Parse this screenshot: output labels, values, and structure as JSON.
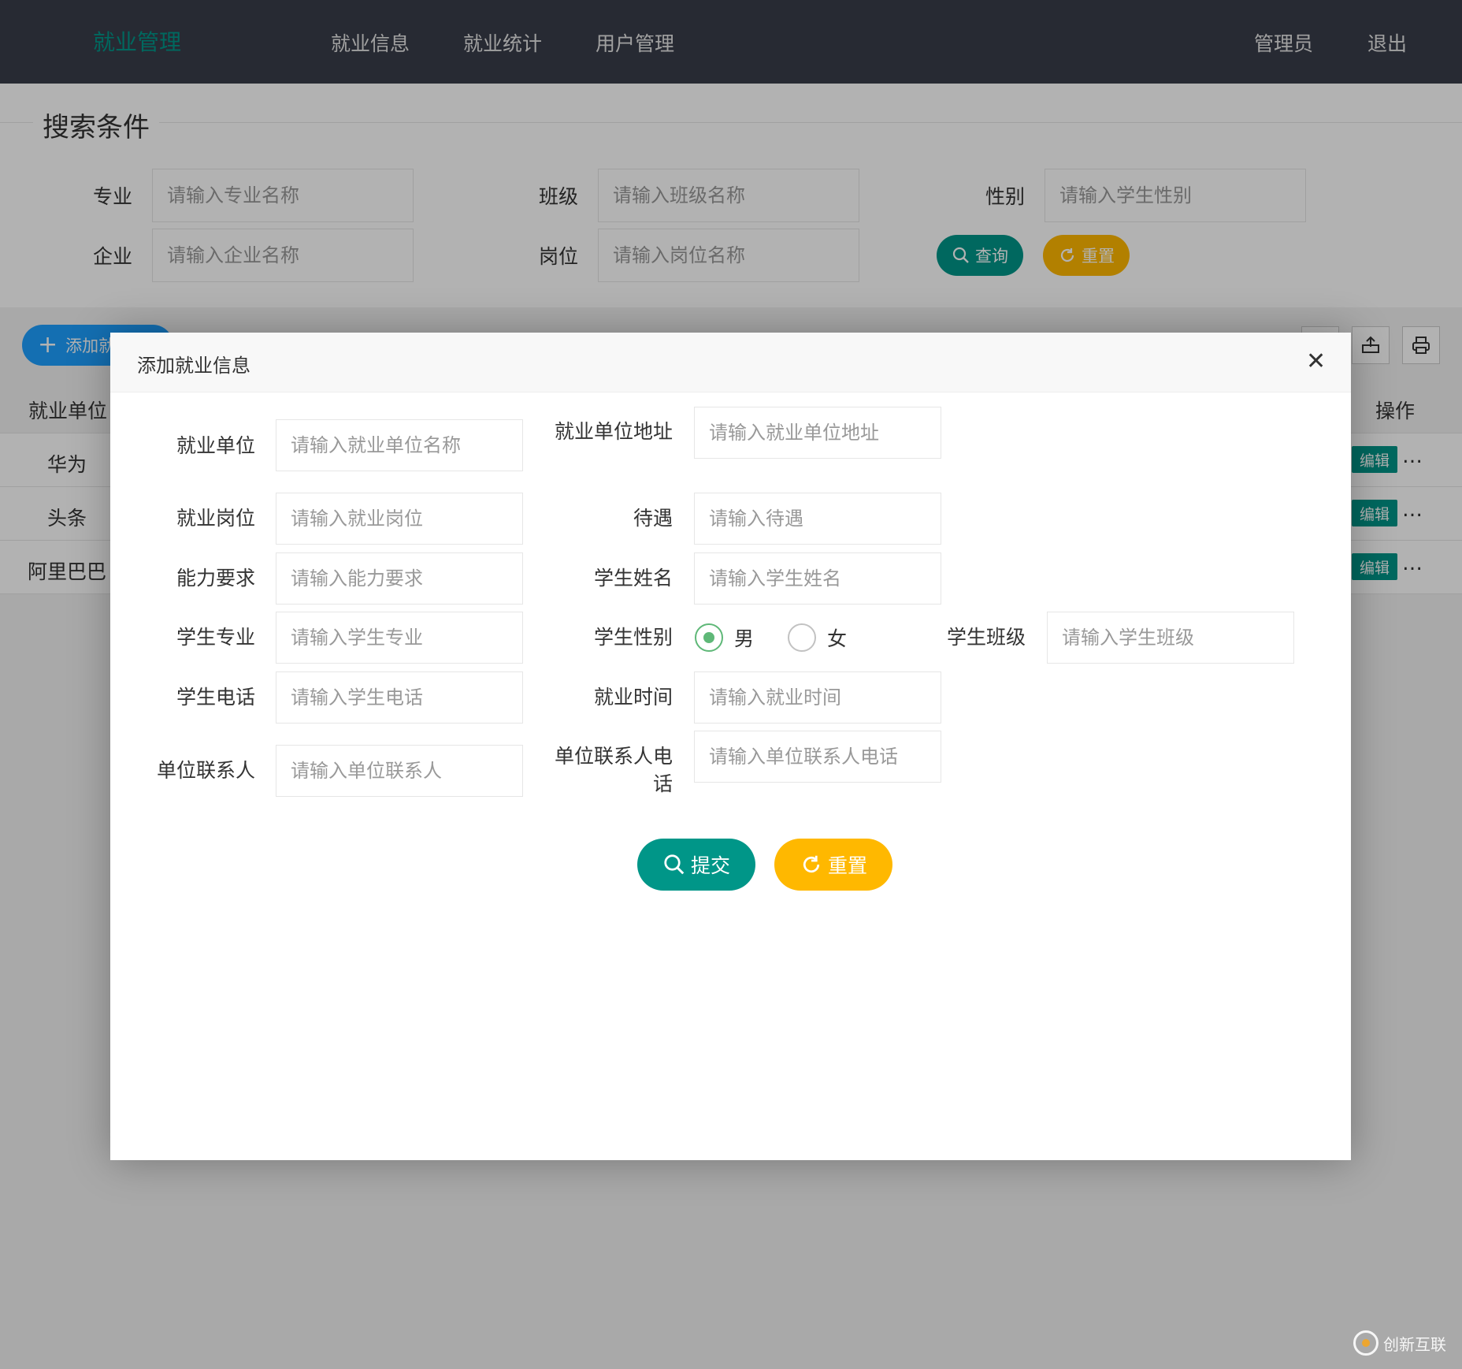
{
  "header": {
    "logo": "就业管理",
    "nav": [
      "就业信息",
      "就业统计",
      "用户管理"
    ],
    "admin": "管理员",
    "logout": "退出"
  },
  "search": {
    "legend": "搜索条件",
    "major_label": "专业",
    "major_placeholder": "请输入专业名称",
    "class_label": "班级",
    "class_placeholder": "请输入班级名称",
    "gender_label": "性别",
    "gender_placeholder": "请输入学生性别",
    "company_label": "企业",
    "company_placeholder": "请输入企业名称",
    "position_label": "岗位",
    "position_placeholder": "请输入岗位名称",
    "query_label": "查询",
    "reset_label": "重置"
  },
  "toolbar": {
    "add_label": "添加就"
  },
  "table": {
    "headers": {
      "unit": "就业单位",
      "op": "操作"
    },
    "rows": [
      {
        "unit": "华为"
      },
      {
        "unit": "头条"
      },
      {
        "unit": "阿里巴巴"
      }
    ],
    "edit_label": "编辑",
    "more_label": "…"
  },
  "modal": {
    "title": "添加就业信息",
    "close": "✕",
    "fields": {
      "unit": {
        "label": "就业单位",
        "placeholder": "请输入就业单位名称"
      },
      "address": {
        "label": "就业单位地址",
        "placeholder": "请输入就业单位地址"
      },
      "post": {
        "label": "就业岗位",
        "placeholder": "请输入就业岗位"
      },
      "salary": {
        "label": "待遇",
        "placeholder": "请输入待遇"
      },
      "ability": {
        "label": "能力要求",
        "placeholder": "请输入能力要求"
      },
      "name": {
        "label": "学生姓名",
        "placeholder": "请输入学生姓名"
      },
      "major": {
        "label": "学生专业",
        "placeholder": "请输入学生专业"
      },
      "gender": {
        "label": "学生性别",
        "options": [
          "男",
          "女"
        ],
        "selected": "男"
      },
      "class": {
        "label": "学生班级",
        "placeholder": "请输入学生班级"
      },
      "phone": {
        "label": "学生电话",
        "placeholder": "请输入学生电话"
      },
      "time": {
        "label": "就业时间",
        "placeholder": "请输入就业时间"
      },
      "contact": {
        "label": "单位联系人",
        "placeholder": "请输入单位联系人"
      },
      "contact_phone": {
        "label": "单位联系人电话",
        "placeholder": "请输入单位联系人电话"
      }
    },
    "submit_label": "提交",
    "reset_label": "重置"
  },
  "watermark": "创新互联",
  "colors": {
    "header_bg": "#393d49",
    "accent": "#009688",
    "warm": "#ffb800",
    "blue": "#1e9fff",
    "radio": "#5fb878"
  }
}
